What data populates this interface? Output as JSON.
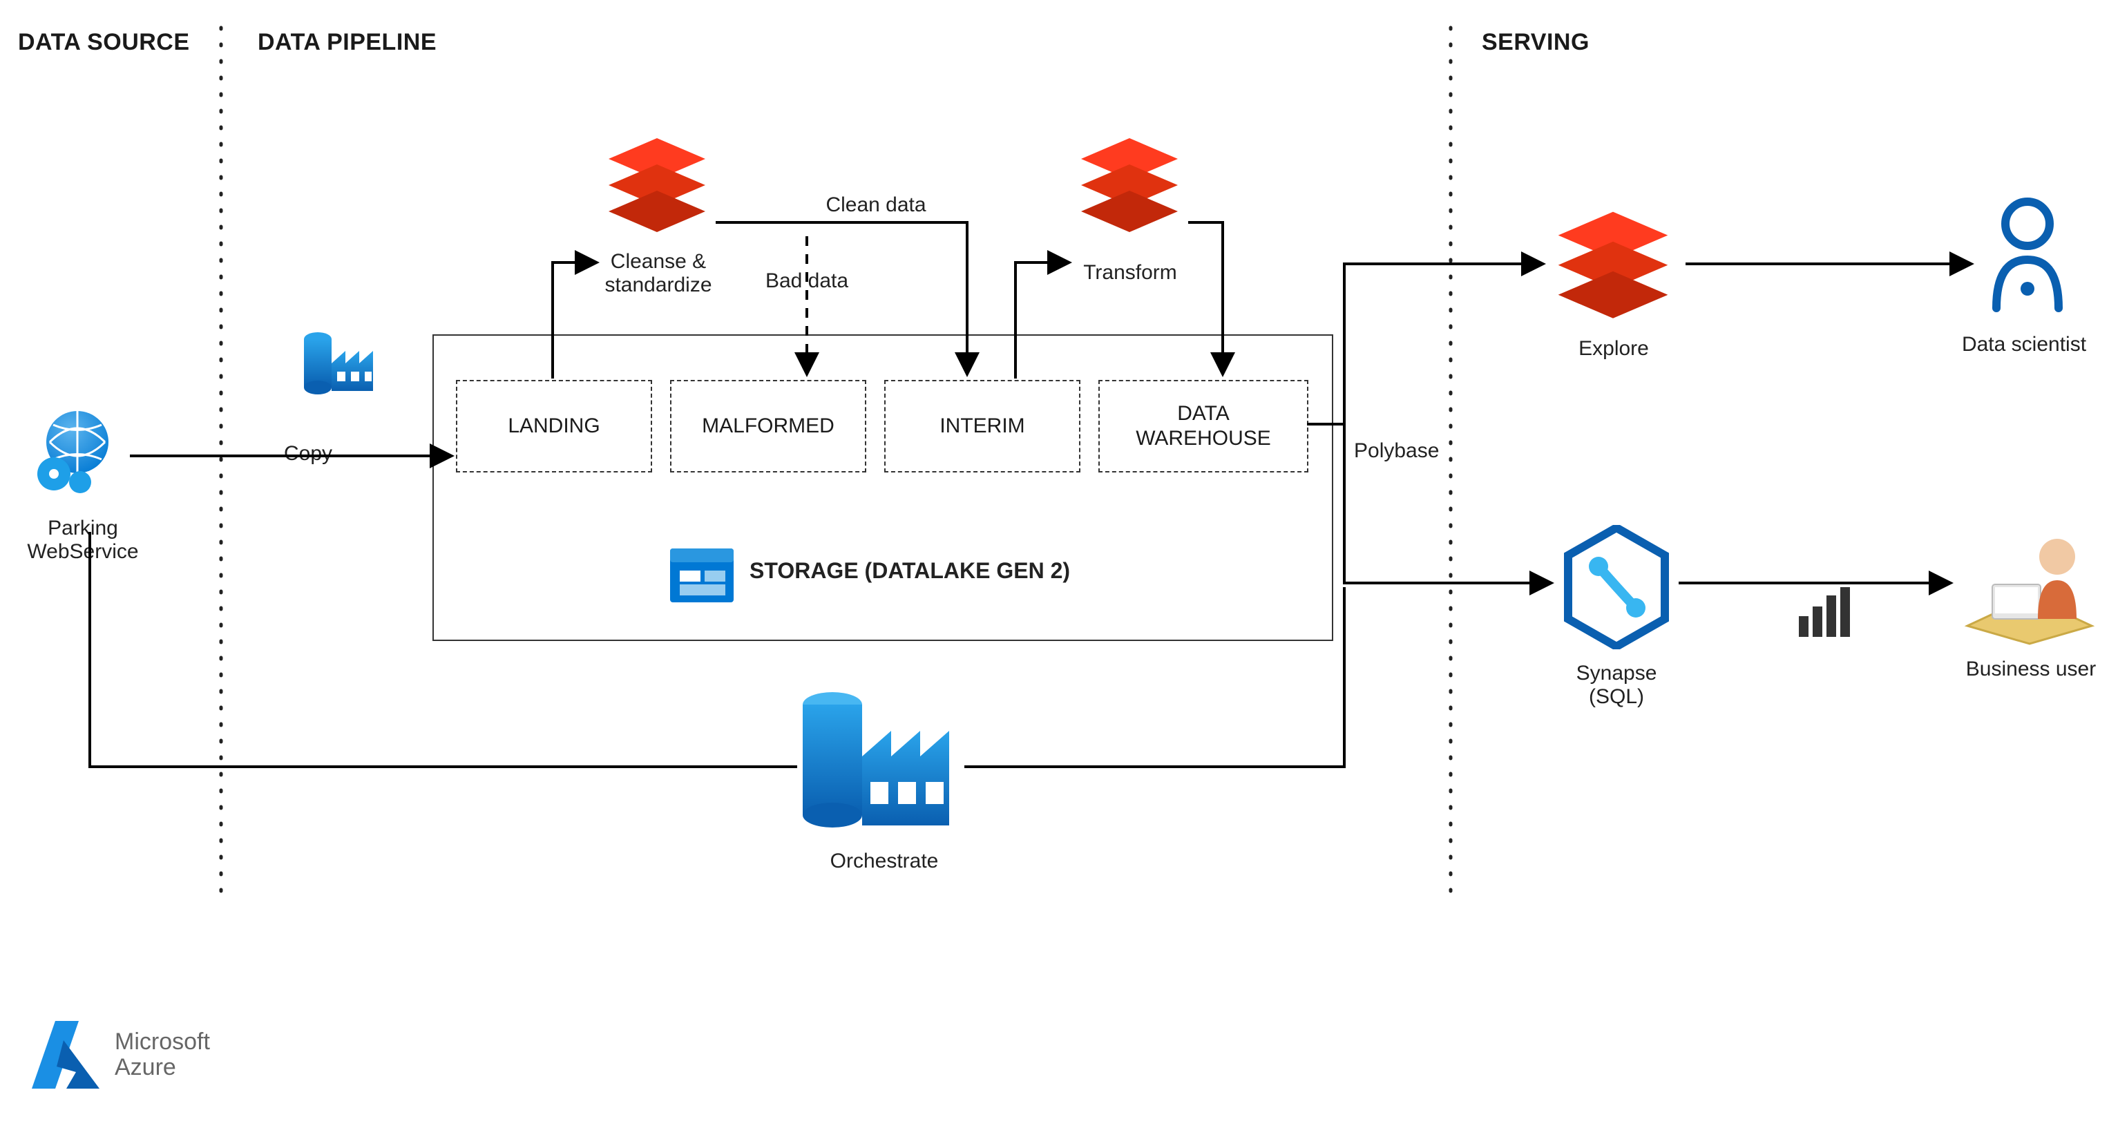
{
  "sections": {
    "data_source": "DATA SOURCE",
    "data_pipeline": "DATA PIPELINE",
    "serving": "SERVING"
  },
  "nodes": {
    "parking": "Parking\nWebService",
    "copy": "Copy",
    "cleanse": "Cleanse &\nstandardize",
    "clean_data": "Clean data",
    "bad_data": "Bad data",
    "transform": "Transform",
    "polybase": "Polybase",
    "storage_title": "STORAGE (DATALAKE GEN 2)",
    "orchestrate": "Orchestrate",
    "explore": "Explore",
    "data_scientist": "Data scientist",
    "synapse": "Synapse\n(SQL)",
    "business_user": "Business user"
  },
  "stages": {
    "landing": "LANDING",
    "malformed": "MALFORMED",
    "interim": "INTERIM",
    "data_warehouse": "DATA\nWAREHOUSE"
  },
  "logo": {
    "line1": "Microsoft",
    "line2": "Azure"
  },
  "chart_data": {
    "type": "diagram",
    "title": "Data pipeline architecture on Azure",
    "sections": [
      "DATA SOURCE",
      "DATA PIPELINE",
      "SERVING"
    ],
    "nodes": [
      {
        "id": "parking",
        "label": "Parking WebService",
        "section": "DATA SOURCE",
        "icon": "globe-gears"
      },
      {
        "id": "copy_factory",
        "label": "Copy",
        "section": "DATA PIPELINE",
        "icon": "data-factory"
      },
      {
        "id": "cleanse",
        "label": "Cleanse & standardize",
        "section": "DATA PIPELINE",
        "icon": "databricks"
      },
      {
        "id": "transform",
        "label": "Transform",
        "section": "DATA PIPELINE",
        "icon": "databricks"
      },
      {
        "id": "storage",
        "label": "STORAGE (DATALAKE GEN 2)",
        "section": "DATA PIPELINE",
        "icon": "storage"
      },
      {
        "id": "landing",
        "label": "LANDING",
        "parent": "storage"
      },
      {
        "id": "malformed",
        "label": "MALFORMED",
        "parent": "storage"
      },
      {
        "id": "interim",
        "label": "INTERIM",
        "parent": "storage"
      },
      {
        "id": "data_warehouse",
        "label": "DATA WAREHOUSE",
        "parent": "storage"
      },
      {
        "id": "orchestrate",
        "label": "Orchestrate",
        "section": "DATA PIPELINE",
        "icon": "data-factory-large"
      },
      {
        "id": "explore",
        "label": "Explore",
        "section": "SERVING",
        "icon": "databricks"
      },
      {
        "id": "synapse",
        "label": "Synapse (SQL)",
        "section": "SERVING",
        "icon": "synapse"
      },
      {
        "id": "data_scientist",
        "label": "Data scientist",
        "section": "SERVING",
        "icon": "person"
      },
      {
        "id": "business_user",
        "label": "Business user",
        "section": "SERVING",
        "icon": "business-user"
      },
      {
        "id": "powerbi",
        "label": "",
        "section": "SERVING",
        "icon": "power-bi"
      }
    ],
    "edges": [
      {
        "from": "parking",
        "to": "landing",
        "label": "Copy",
        "style": "solid"
      },
      {
        "from": "landing",
        "to": "cleanse",
        "label": "",
        "style": "solid"
      },
      {
        "from": "cleanse",
        "to": "interim",
        "label": "Clean data",
        "style": "solid"
      },
      {
        "from": "cleanse",
        "to": "malformed",
        "label": "Bad data",
        "style": "dashed"
      },
      {
        "from": "interim",
        "to": "transform",
        "label": "",
        "style": "solid"
      },
      {
        "from": "transform",
        "to": "data_warehouse",
        "label": "",
        "style": "solid"
      },
      {
        "from": "data_warehouse",
        "to": "explore",
        "label": "",
        "style": "solid"
      },
      {
        "from": "data_warehouse",
        "to": "synapse",
        "label": "Polybase",
        "style": "solid"
      },
      {
        "from": "orchestrate",
        "to": "parking",
        "label": "",
        "style": "solid"
      },
      {
        "from": "orchestrate",
        "to": "synapse",
        "label": "",
        "style": "solid"
      },
      {
        "from": "explore",
        "to": "data_scientist",
        "label": "",
        "style": "solid"
      },
      {
        "from": "synapse",
        "to": "business_user",
        "label": "",
        "style": "solid"
      }
    ]
  }
}
